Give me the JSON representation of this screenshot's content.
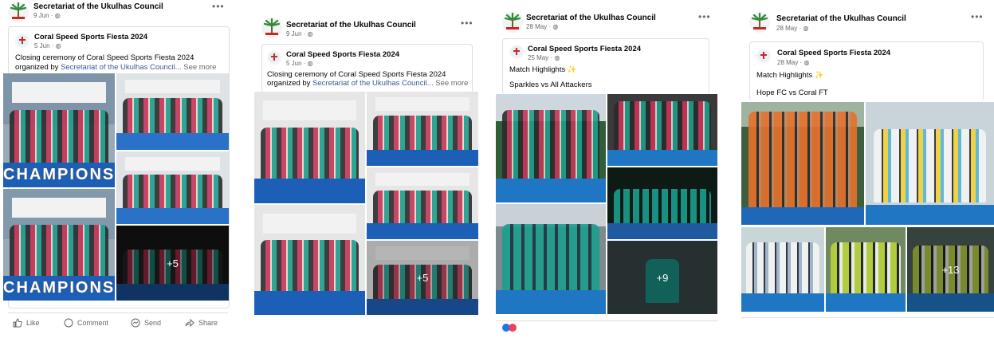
{
  "posts": [
    {
      "author": "Secretariat of the Ukulhas Council",
      "date": "9 Jun ·",
      "shared": {
        "title": "Coral Speed Sports Fiesta 2024",
        "date": "5 Jun ·"
      },
      "text": "Closing ceremony of Coral Speed Sports Fiesta 2024",
      "text2_prefix": "organized by ",
      "text2_link": "Secretariat of the Ukulhas Council...",
      "see_more": "See more",
      "captions": {
        "c1": "CHAMPIONS",
        "c2": "CHAMPIONS"
      },
      "more_count": "+5",
      "actions": {
        "like": "Like",
        "comment": "Comment",
        "send": "Send",
        "share": "Share"
      }
    },
    {
      "author": "Secretariat of the Ukulhas Council",
      "date": "9 Jun ·",
      "shared": {
        "title": "Coral Speed Sports Fiesta 2024",
        "date": "5 Jun ·"
      },
      "text": "Closing ceremony of Coral Speed Sports Fiesta 2024",
      "text2_prefix": "organized by ",
      "text2_link": "Secretariat of the Ukulhas Council...",
      "see_more": "See more",
      "more_count": "+5"
    },
    {
      "author": "Secretariat of the Ukulhas Council",
      "date": "28 May ·",
      "shared": {
        "title": "Coral Speed Sports Fiesta 2024",
        "date": "25 May ·"
      },
      "text": "Match Highlights ✨",
      "text2": "Sparkles vs All Attackers",
      "more_count": "+9"
    },
    {
      "author": "Secretariat of the Ukulhas Council",
      "date": "28 May ·",
      "shared": {
        "title": "Coral Speed Sports Fiesta 2024",
        "date": "28 May ·"
      },
      "text": "Match Highlights ✨",
      "text2": "Hope FC vs Coral FT",
      "more_count": "+13"
    }
  ],
  "icons": {
    "globe": "globe-icon",
    "more": "more-options-icon",
    "like": "thumbs-up-icon",
    "comment": "comment-icon",
    "send": "messenger-icon",
    "share": "share-arrow-icon"
  },
  "colors": {
    "link": "#385898",
    "muted": "#65676b",
    "pink_jersey": "#c7335a",
    "teal_jersey": "#1a9e8e",
    "orange_jersey": "#e8702a",
    "court": "#1c5fb7"
  }
}
